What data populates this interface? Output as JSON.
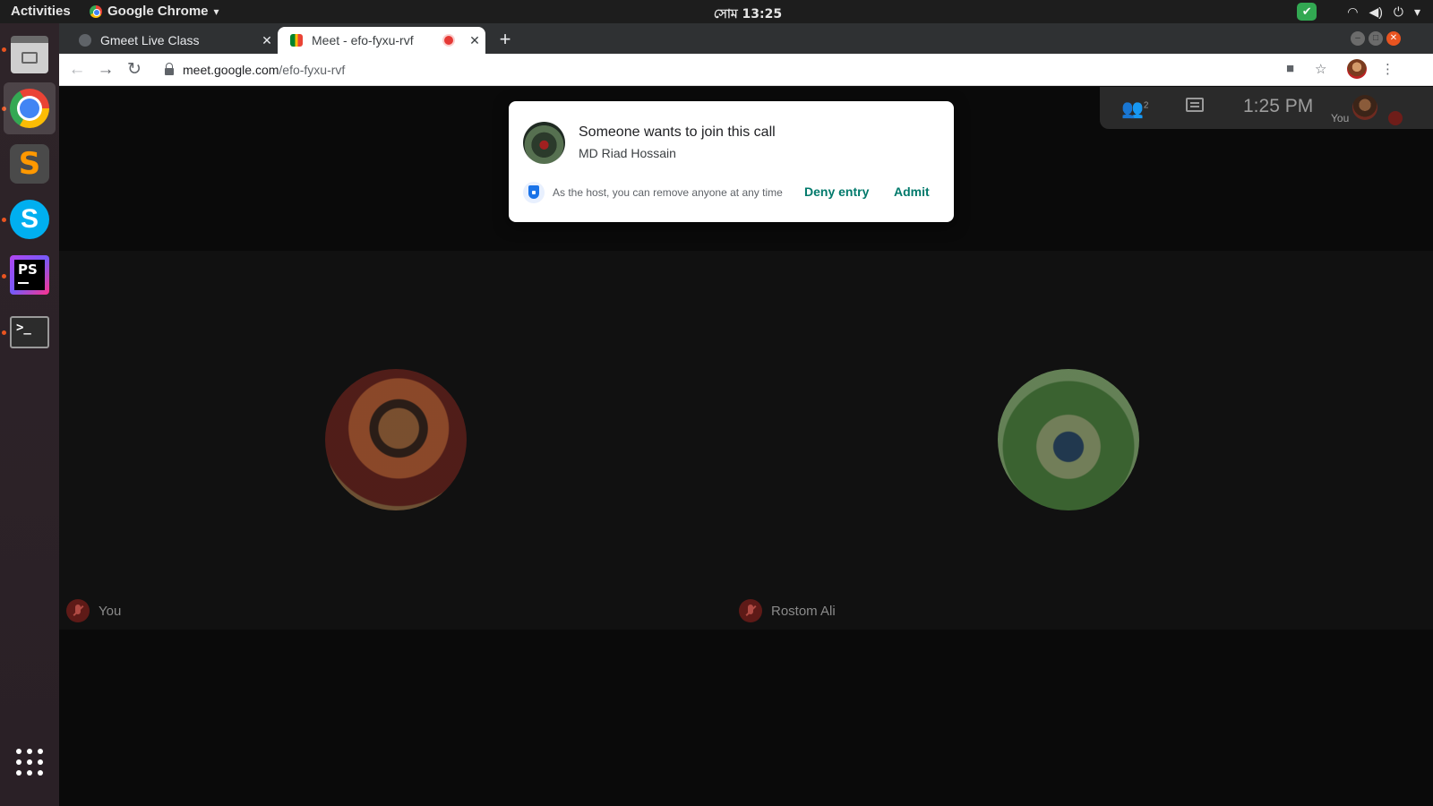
{
  "os_bar": {
    "activities": "Activities",
    "app_name": "Google Chrome",
    "clock": "সোম 13:25",
    "app_menu_arrow": "▾"
  },
  "dock": {
    "items": [
      "files",
      "google-chrome",
      "sublime-text",
      "skype",
      "phpstorm",
      "terminal"
    ],
    "show_apps_icon": "apps-grid-icon"
  },
  "browser": {
    "tabs": [
      {
        "title": "Gmeet Live Class",
        "active": false
      },
      {
        "title": "Meet - efo-fyxu-rvf",
        "active": true,
        "recording": true
      }
    ],
    "new_tab_label": "+",
    "url_host": "meet.google.com",
    "url_path": "/efo-fyxu-rvf"
  },
  "meet": {
    "call_info": {
      "participant_count": "2",
      "time": "1:25 PM",
      "self_label": "You"
    },
    "join_request": {
      "title": "Someone wants to join this call",
      "requester_name": "MD Riad Hossain",
      "host_note": "As the host, you can remove anyone at any time",
      "deny_label": "Deny entry",
      "admit_label": "Admit"
    },
    "participants": [
      {
        "name": "You",
        "muted": true
      },
      {
        "name": "Rostom Ali",
        "muted": true
      }
    ]
  },
  "colors": {
    "accent_admit": "#00796b",
    "dock_indicator": "#e95420",
    "record_dot": "#e53935"
  }
}
